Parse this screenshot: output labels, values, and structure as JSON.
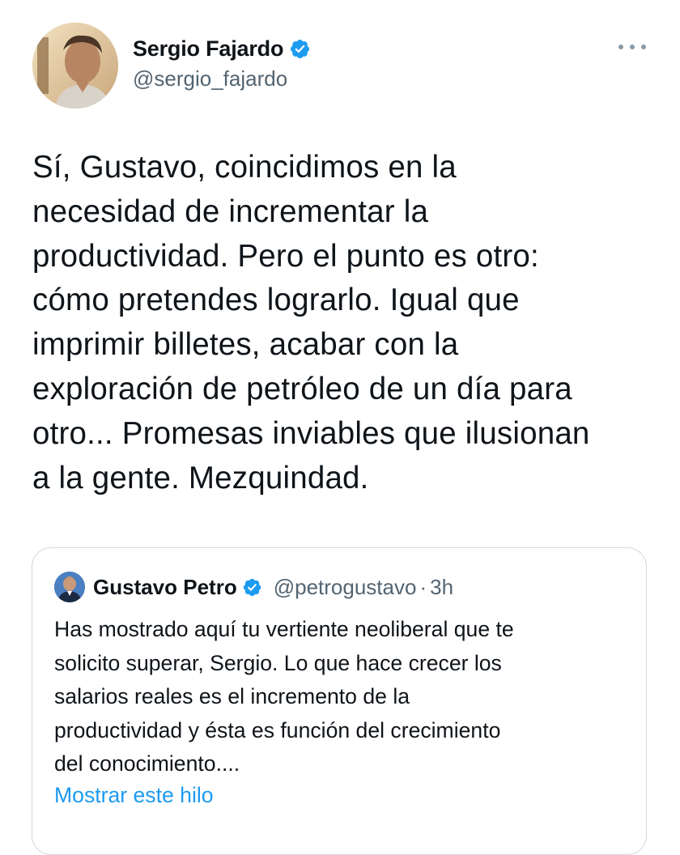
{
  "author": {
    "name": "Sergio Fajardo",
    "handle": "@sergio_fajardo",
    "verified": true
  },
  "tweet": {
    "lines": [
      "Sí, Gustavo, coincidimos en la",
      "necesidad de incrementar la",
      "productividad. Pero el punto es otro:",
      "cómo pretendes lograrlo. Igual que",
      "imprimir billetes, acabar con la",
      "exploración de petróleo de un día para",
      "otro... Promesas inviables que ilusionan",
      "a la gente. Mezquindad."
    ]
  },
  "quoted_tweet": {
    "author_name": "Gustavo Petro",
    "author_handle": "@petrogustavo",
    "separator": "·",
    "time": "3h",
    "verified": true,
    "lines": [
      "Has mostrado aquí tu vertiente neoliberal que te",
      "solicito superar, Sergio. Lo que hace crecer los",
      "salarios reales es el incremento de la",
      "productividad y ésta es función del crecimiento",
      "del conocimiento...."
    ],
    "show_thread_label": "Mostrar este hilo"
  },
  "icons": {
    "verified": "verified-badge-icon",
    "more": "more-options-icon"
  },
  "colors": {
    "verified_blue": "#1d9bf0",
    "link_blue": "#1d9bf0",
    "secondary_text": "#536471",
    "border": "#cfd9de"
  }
}
